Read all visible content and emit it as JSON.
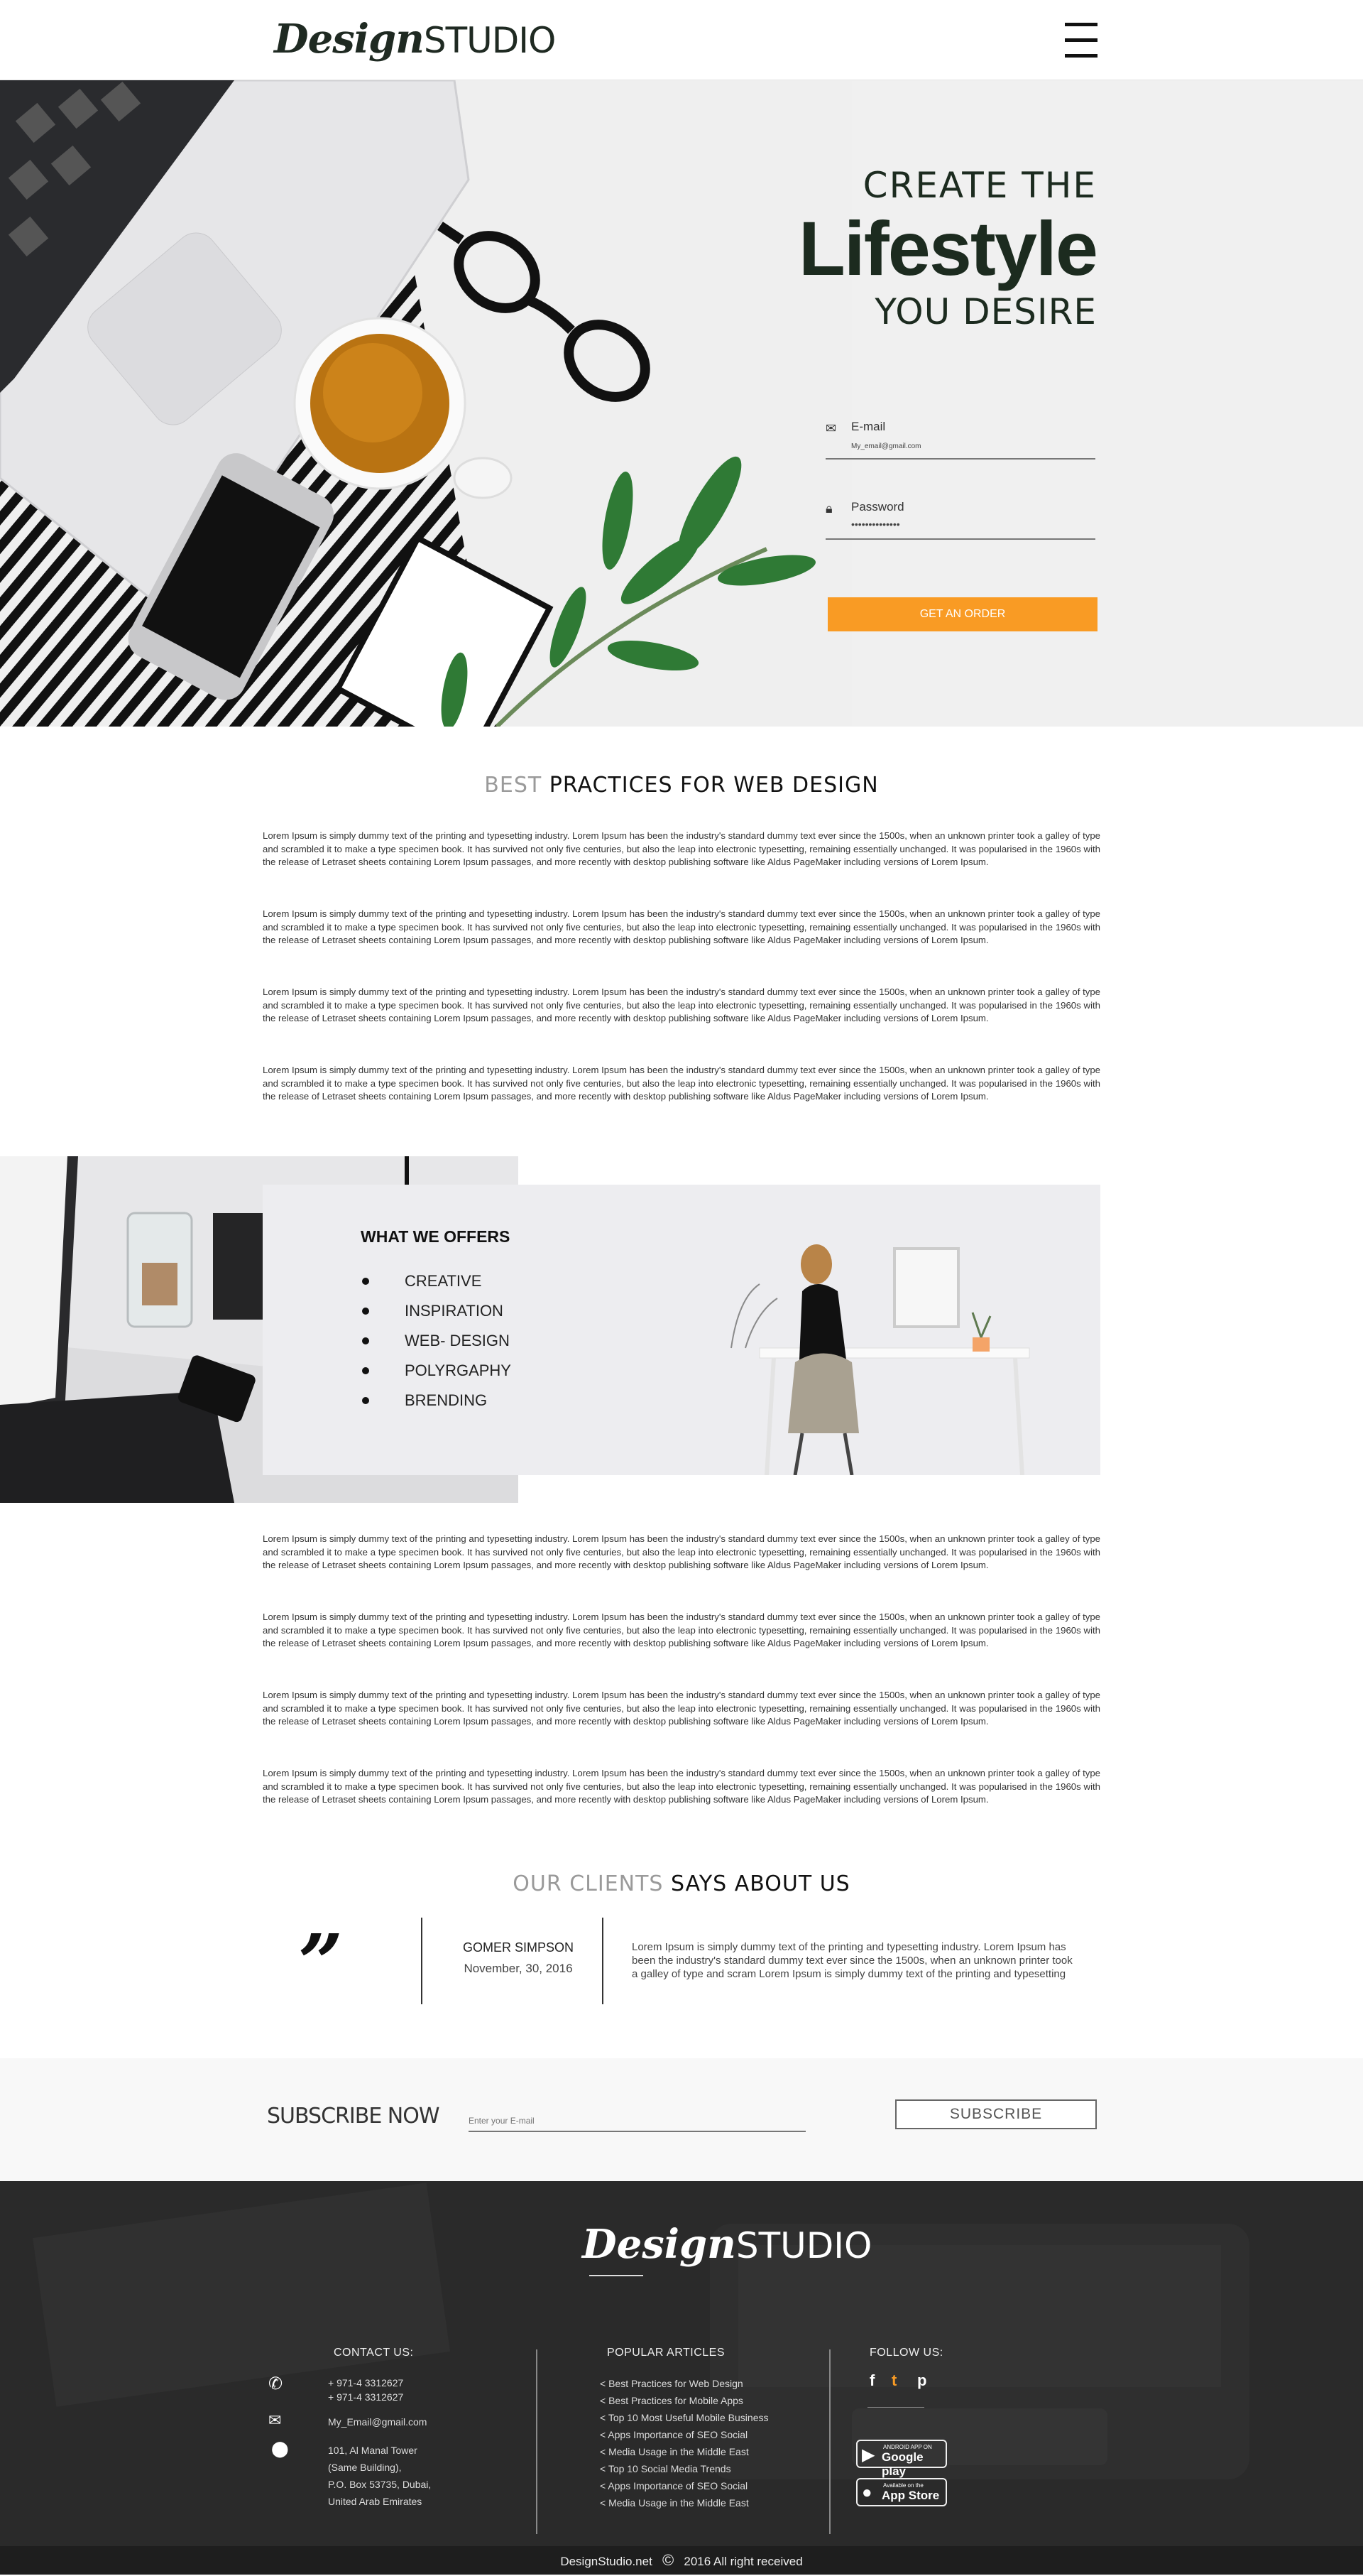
{
  "header": {
    "logo_bold": "Design",
    "logo_light": "STUDIO",
    "menu_icon": "hamburger-icon"
  },
  "hero": {
    "title_line1": "CREATE THE",
    "title_line2": "Lifestyle",
    "title_line3": "YOU DESIRE",
    "email_label": "E-mail",
    "email_value": "My_email@gmail.com",
    "password_label": "Password",
    "password_value": "••••••••••••••",
    "order_button": "GET AN ORDER",
    "accent_color": "#f99b24"
  },
  "practices": {
    "title_light": "BEST",
    "title_dark": " PRACTICES FOR WEB DESIGN",
    "paragraphs": [
      "Lorem Ipsum is simply dummy text of the printing and typesetting industry. Lorem Ipsum has been the industry's standard dummy text ever since the 1500s, when an unknown printer took a galley of type and scrambled it to make a type specimen book. It has survived not only five centuries, but also the leap into electronic typesetting, remaining essentially unchanged. It was popularised in the 1960s with the release of Letraset sheets containing Lorem Ipsum passages, and more recently with desktop publishing software like Aldus PageMaker including versions of Lorem Ipsum.",
      "Lorem Ipsum is simply dummy text of the printing and typesetting industry. Lorem Ipsum has been the industry's standard dummy text ever since the 1500s, when an unknown printer took a galley of type and scrambled it to make a type specimen book. It has survived not only five centuries, but also the leap into electronic typesetting, remaining essentially unchanged. It was popularised in the 1960s with the release of Letraset sheets containing Lorem Ipsum passages, and more recently with desktop publishing software like Aldus PageMaker including versions of Lorem Ipsum.",
      "Lorem Ipsum is simply dummy text of the printing and typesetting industry. Lorem Ipsum has been the industry's standard dummy text ever since the 1500s, when an unknown printer took a galley of type and scrambled it to make a type specimen book. It has survived not only five centuries, but also the leap into electronic typesetting, remaining essentially unchanged. It was popularised in the 1960s with the release of Letraset sheets containing Lorem Ipsum passages, and more recently with desktop publishing software like Aldus PageMaker including versions of Lorem Ipsum.",
      "Lorem Ipsum is simply dummy text of the printing and typesetting industry. Lorem Ipsum has been the industry's standard dummy text ever since the 1500s, when an unknown printer took a galley of type and scrambled it to make a type specimen book. It has survived not only five centuries, but also the leap into electronic typesetting, remaining essentially unchanged. It was popularised in the 1960s with the release of Letraset sheets containing Lorem Ipsum passages, and more recently with desktop publishing software like Aldus PageMaker including versions of Lorem Ipsum."
    ]
  },
  "offers": {
    "title": "WHAT WE OFFERS",
    "items": [
      "CREATIVE",
      "INSPIRATION",
      "WEB- DESIGN",
      "POLYRGAPHY",
      "BRENDING"
    ]
  },
  "more_text": {
    "paragraphs": [
      "Lorem Ipsum is simply dummy text of the printing and typesetting industry. Lorem Ipsum has been the industry's standard dummy text ever since the 1500s, when an unknown printer took a galley of type and scrambled it to make a type specimen book. It has survived not only five centuries, but also the leap into electronic typesetting, remaining essentially unchanged. It was popularised in the 1960s with the release of Letraset sheets containing Lorem Ipsum passages, and more recently with desktop publishing software like Aldus PageMaker including versions of Lorem Ipsum.",
      "Lorem Ipsum is simply dummy text of the printing and typesetting industry. Lorem Ipsum has been the industry's standard dummy text ever since the 1500s, when an unknown printer took a galley of type and scrambled it to make a type specimen book. It has survived not only five centuries, but also the leap into electronic typesetting, remaining essentially unchanged. It was popularised in the 1960s with the release of Letraset sheets containing Lorem Ipsum passages, and more recently with desktop publishing software like Aldus PageMaker including versions of Lorem Ipsum.",
      "Lorem Ipsum is simply dummy text of the printing and typesetting industry. Lorem Ipsum has been the industry's standard dummy text ever since the 1500s, when an unknown printer took a galley of type and scrambled it to make a type specimen book. It has survived not only five centuries, but also the leap into electronic typesetting, remaining essentially unchanged. It was popularised in the 1960s with the release of Letraset sheets containing Lorem Ipsum passages, and more recently with desktop publishing software like Aldus PageMaker including versions of Lorem Ipsum.",
      "Lorem Ipsum is simply dummy text of the printing and typesetting industry. Lorem Ipsum has been the industry's standard dummy text ever since the 1500s, when an unknown printer took a galley of type and scrambled it to make a type specimen book. It has survived not only five centuries, but also the leap into electronic typesetting, remaining essentially unchanged. It was popularised in the 1960s with the release of Letraset sheets containing Lorem Ipsum passages, and more recently with desktop publishing software like Aldus PageMaker including versions of Lorem Ipsum."
    ]
  },
  "clients": {
    "title_light": "OUR CLIENTS",
    "title_dark": " SAYS ABOUT US",
    "quote_mark": "”",
    "name": "GOMER SIMPSON",
    "date": "November, 30, 2016",
    "text": "Lorem Ipsum is simply dummy text of the printing and typesetting industry. Lorem Ipsum has been the industry's standard dummy text ever since the 1500s, when an unknown printer took a galley of type and scram Lorem Ipsum is simply dummy text of the printing and typesetting"
  },
  "subscribe": {
    "title": "SUBSCRIBE NOW",
    "placeholder": "Enter your E-mail",
    "button": "SUBSCRIBE"
  },
  "footer": {
    "logo_bold": "Design",
    "logo_light": "STUDIO",
    "contact_title": "CONTACT US:",
    "phone1": "+ 971-4 3312627",
    "phone2": "+ 971-4 3312627",
    "email": "My_Email@gmail.com",
    "address": [
      "101, Al Manal Tower",
      "(Same Building),",
      "P.O. Box 53735, Dubai,",
      "United Arab Emirates"
    ],
    "articles_title": "POPULAR ARTICLES",
    "articles": [
      "< Best Practices for Web Design",
      "< Best Practices for Mobile Apps",
      "< Top 10 Most Useful Mobile Business",
      "< Apps Importance of SEO Social",
      "< Media Usage in the Middle East",
      "< Top 10 Social Media Trends",
      "< Apps Importance of SEO Social",
      "< Media Usage in the Middle East"
    ],
    "follow_title": "FOLLOW US:",
    "social": [
      {
        "icon": "facebook-icon",
        "glyph": "f",
        "color": "#ffffff"
      },
      {
        "icon": "twitter-icon",
        "glyph": "t",
        "color": "#f99b24"
      },
      {
        "icon": "pinterest-icon",
        "glyph": "p",
        "color": "#ffffff"
      }
    ],
    "google_play_small": "ANDROID APP ON",
    "google_play_big": "Google play",
    "app_store_small": "Available on the",
    "app_store_big": "App Store",
    "bottom_site": "DesignStudio.net",
    "bottom_copy": "©",
    "bottom_text": "2016 All right received"
  }
}
